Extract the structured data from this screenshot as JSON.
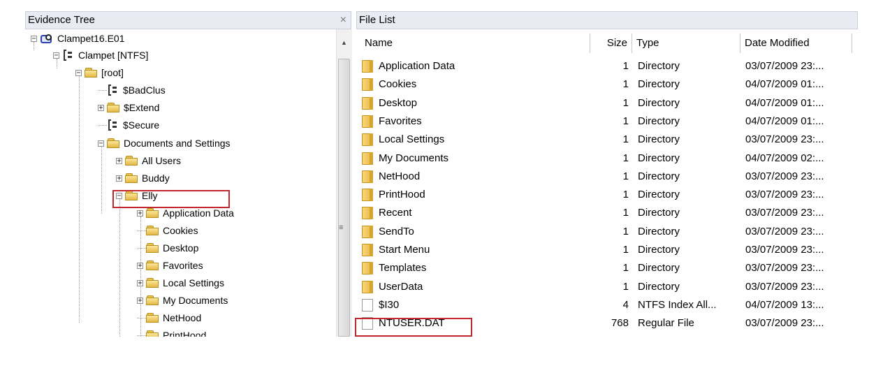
{
  "tree_panel": {
    "title": "Evidence Tree",
    "close_glyph": "×"
  },
  "list_panel": {
    "title": "File List"
  },
  "tree": [
    {
      "label": "Clampet16.E01",
      "icon": "evidence-icon",
      "expander": "−"
    },
    {
      "label": "Clampet [NTFS]",
      "icon": "drive-icon",
      "expander": "−"
    },
    {
      "label": "[root]",
      "icon": "folder-icon",
      "expander": "−"
    },
    {
      "label": "$BadClus",
      "icon": "drive-icon",
      "expander": ""
    },
    {
      "label": "$Extend",
      "icon": "folder-icon",
      "expander": "+"
    },
    {
      "label": "$Secure",
      "icon": "drive-icon",
      "expander": ""
    },
    {
      "label": "Documents and Settings",
      "icon": "folder-icon",
      "expander": "−"
    },
    {
      "label": "All Users",
      "icon": "folder-icon",
      "expander": "+"
    },
    {
      "label": "Buddy",
      "icon": "folder-icon",
      "expander": "+"
    },
    {
      "label": "Elly",
      "icon": "folder-icon",
      "expander": "−"
    },
    {
      "label": "Application Data",
      "icon": "folder-icon",
      "expander": "+"
    },
    {
      "label": "Cookies",
      "icon": "folder-icon",
      "expander": ""
    },
    {
      "label": "Desktop",
      "icon": "folder-icon",
      "expander": ""
    },
    {
      "label": "Favorites",
      "icon": "folder-icon",
      "expander": "+"
    },
    {
      "label": "Local Settings",
      "icon": "folder-icon",
      "expander": "+"
    },
    {
      "label": "My Documents",
      "icon": "folder-icon",
      "expander": "+"
    },
    {
      "label": "NetHood",
      "icon": "folder-icon",
      "expander": ""
    },
    {
      "label": "PrintHood",
      "icon": "folder-icon",
      "expander": ""
    }
  ],
  "columns": {
    "name": "Name",
    "size": "Size",
    "type": "Type",
    "date": "Date Modified"
  },
  "files": [
    {
      "name": "Application Data",
      "size": "1",
      "type": "Directory",
      "date": "03/07/2009 23:...",
      "icon": "folder"
    },
    {
      "name": "Cookies",
      "size": "1",
      "type": "Directory",
      "date": "04/07/2009 01:...",
      "icon": "folder"
    },
    {
      "name": "Desktop",
      "size": "1",
      "type": "Directory",
      "date": "04/07/2009 01:...",
      "icon": "folder"
    },
    {
      "name": "Favorites",
      "size": "1",
      "type": "Directory",
      "date": "04/07/2009 01:...",
      "icon": "folder"
    },
    {
      "name": "Local Settings",
      "size": "1",
      "type": "Directory",
      "date": "03/07/2009 23:...",
      "icon": "folder"
    },
    {
      "name": "My Documents",
      "size": "1",
      "type": "Directory",
      "date": "04/07/2009 02:...",
      "icon": "folder"
    },
    {
      "name": "NetHood",
      "size": "1",
      "type": "Directory",
      "date": "03/07/2009 23:...",
      "icon": "folder"
    },
    {
      "name": "PrintHood",
      "size": "1",
      "type": "Directory",
      "date": "03/07/2009 23:...",
      "icon": "folder"
    },
    {
      "name": "Recent",
      "size": "1",
      "type": "Directory",
      "date": "03/07/2009 23:...",
      "icon": "folder"
    },
    {
      "name": "SendTo",
      "size": "1",
      "type": "Directory",
      "date": "03/07/2009 23:...",
      "icon": "folder"
    },
    {
      "name": "Start Menu",
      "size": "1",
      "type": "Directory",
      "date": "03/07/2009 23:...",
      "icon": "folder"
    },
    {
      "name": "Templates",
      "size": "1",
      "type": "Directory",
      "date": "03/07/2009 23:...",
      "icon": "folder"
    },
    {
      "name": "UserData",
      "size": "1",
      "type": "Directory",
      "date": "03/07/2009 23:...",
      "icon": "folder"
    },
    {
      "name": "$I30",
      "size": "4",
      "type": "NTFS Index All...",
      "date": "04/07/2009 13:...",
      "icon": "file"
    },
    {
      "name": "NTUSER.DAT",
      "size": "768",
      "type": "Regular File",
      "date": "03/07/2009 23:...",
      "icon": "file"
    }
  ],
  "highlight_color": "#c0282d"
}
